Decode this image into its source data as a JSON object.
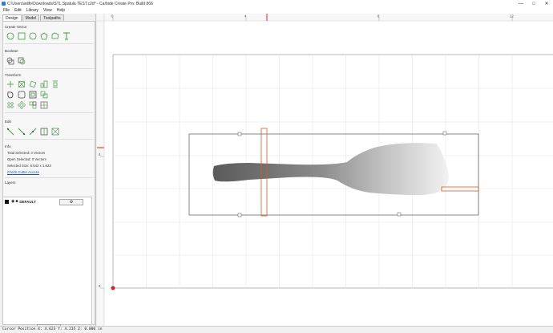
{
  "window": {
    "title": "C:\\Users\\wilfo\\Downloads\\STL Spatula TEST.c2d* - Carbide Create Pro: Build 866",
    "minimize": "—",
    "maximize": "□",
    "close": "✕"
  },
  "menu": [
    "File",
    "Edit",
    "Library",
    "View",
    "Help"
  ],
  "tabs": [
    "Design",
    "Model",
    "Toolpaths"
  ],
  "sections": {
    "create_vector": "Create Vector",
    "boolean": "Boolean",
    "transform": "Transform",
    "edit": "Edit",
    "info": "Info",
    "layers": "Layers"
  },
  "info": {
    "total_selected": "Total Selected:  3 Vectors",
    "open_selected": "Open Selected:  0 Vectors",
    "selected_size": "Selected Size:   6.542 x 1.623",
    "check_link": "Check Cutter Access"
  },
  "layers": [
    {
      "name": "DEFAULT",
      "color": "#111111"
    }
  ],
  "layer_settings_label": "⚙",
  "add_layer_label": "+",
  "ruler": {
    "top_labels": [
      "0",
      "4",
      "8",
      "12"
    ],
    "left_labels": [
      "4",
      "0"
    ]
  },
  "status": {
    "cursor": "Cursor Position X: 4.623 Y: 4.235 Z: 0.000 in"
  },
  "colors": {
    "accent_icons": "#3a9a3a",
    "selection_orange": "#e05a1a",
    "link": "#1a4fd6"
  },
  "icons": {
    "create_vector": [
      "circle-tool-icon",
      "rectangle-tool-icon",
      "polygon-tool-icon",
      "pentagon-tool-icon",
      "curve-tool-icon",
      "text-tool-icon"
    ],
    "boolean": [
      "union-icon",
      "intersect-icon"
    ],
    "transform": [
      "move-icon",
      "scale-icon",
      "rotate-icon",
      "mirror-icon",
      "align-icon",
      "offset-icon",
      "fillet-icon",
      "group-icon",
      "array-icon",
      "pattern-icon",
      "distribute-icon"
    ],
    "edit": [
      "node-edit-icon",
      "trim-icon",
      "join-icon",
      "split-icon",
      "fit-icon"
    ]
  }
}
